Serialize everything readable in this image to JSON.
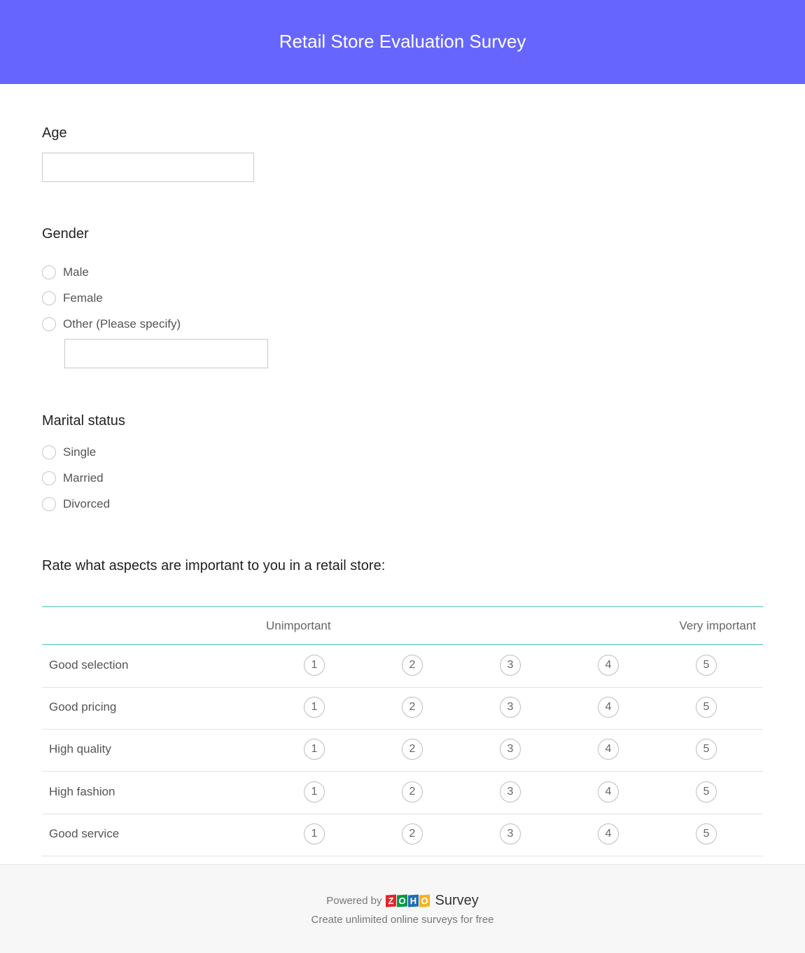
{
  "survey": {
    "title": "Retail Store Evaluation Survey"
  },
  "questions": {
    "age": {
      "label": "Age",
      "value": "",
      "placeholder": ""
    },
    "gender": {
      "label": "Gender",
      "options": [
        "Male",
        "Female",
        "Other (Please specify)"
      ],
      "other_value": ""
    },
    "marital": {
      "label": "Marital status",
      "options": [
        "Single",
        "Married",
        "Divorced"
      ]
    },
    "rating": {
      "label": "Rate what aspects are important to you in a retail store:",
      "scale_low": "Unimportant",
      "scale_high": "Very important",
      "scale_values": [
        "1",
        "2",
        "3",
        "4",
        "5"
      ],
      "rows": [
        "Good selection",
        "Good pricing",
        "High quality",
        "High fashion",
        "Good service"
      ]
    }
  },
  "footer": {
    "powered_by": "Powered by",
    "logo_letters": [
      "Z",
      "O",
      "H",
      "O"
    ],
    "logo_colors": [
      "#e42527",
      "#089949",
      "#226db4",
      "#f9b21d"
    ],
    "product": "Survey",
    "tagline": "Create unlimited online surveys for free"
  },
  "colors": {
    "header_bg": "#6666ff",
    "matrix_rule": "#4fc1b0"
  }
}
